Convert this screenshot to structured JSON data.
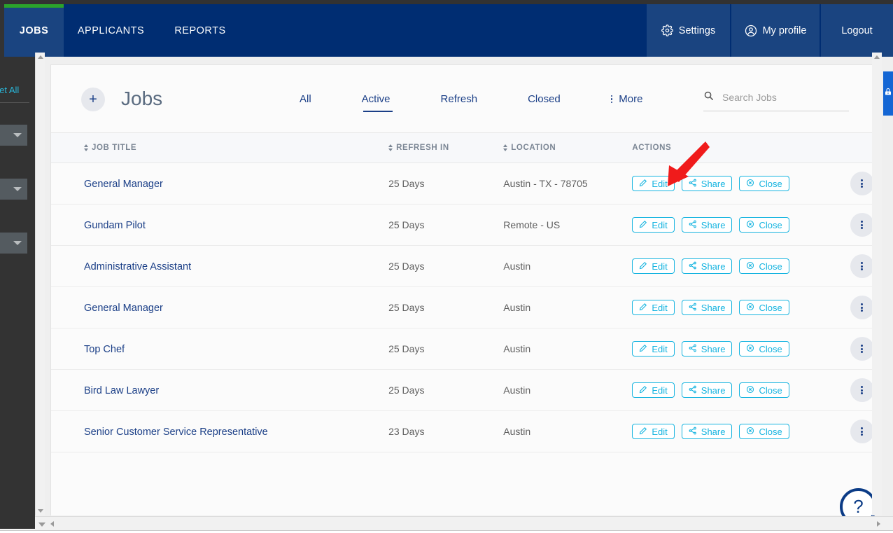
{
  "topnav": {
    "left_items": [
      {
        "label": "JOBS",
        "selected": true
      },
      {
        "label": "APPLICANTS",
        "selected": false
      },
      {
        "label": "REPORTS",
        "selected": false
      }
    ],
    "right_items": [
      {
        "label": "Settings",
        "icon": "gear-icon"
      },
      {
        "label": "My profile",
        "icon": "user-circle-icon"
      },
      {
        "label": "Logout",
        "icon": ""
      }
    ],
    "accent_color": "#2ba32b",
    "background_color": "#002d72",
    "active_color": "#1a4480"
  },
  "sidebar": {
    "reset_all_label": "Reset All",
    "reset_all_color": "#29b6d8"
  },
  "page": {
    "title": "Jobs",
    "add_button_label": "+",
    "tabs": [
      {
        "label": "All",
        "selected": false
      },
      {
        "label": "Active",
        "selected": true
      },
      {
        "label": "Refresh",
        "selected": false
      },
      {
        "label": "Closed",
        "selected": false
      },
      {
        "label": "More",
        "selected": false,
        "icon": "kebab-icon"
      }
    ],
    "search": {
      "placeholder": "Search Jobs",
      "value": "",
      "icon": "search-icon"
    }
  },
  "table": {
    "columns": [
      {
        "label": "JOB TITLE",
        "sortable": true
      },
      {
        "label": "REFRESH IN",
        "sortable": true
      },
      {
        "label": "LOCATION",
        "sortable": true
      },
      {
        "label": "ACTIONS",
        "sortable": false
      }
    ],
    "action_buttons": [
      {
        "label": "Edit",
        "icon": "pencil-icon"
      },
      {
        "label": "Share",
        "icon": "share-nodes-icon"
      },
      {
        "label": "Close",
        "icon": "circle-x-icon"
      }
    ],
    "action_color": "#16b4e0",
    "rows": [
      {
        "title": "General Manager",
        "refresh_in": "25 Days",
        "location": "Austin - TX - 78705"
      },
      {
        "title": "Gundam Pilot",
        "refresh_in": "25 Days",
        "location": "Remote - US"
      },
      {
        "title": "Administrative Assistant",
        "refresh_in": "25 Days",
        "location": "Austin"
      },
      {
        "title": "General Manager",
        "refresh_in": "25 Days",
        "location": "Austin"
      },
      {
        "title": "Top Chef",
        "refresh_in": "25 Days",
        "location": "Austin"
      },
      {
        "title": "Bird Law Lawyer",
        "refresh_in": "25 Days",
        "location": "Austin"
      },
      {
        "title": "Senior Customer Service Representative",
        "refresh_in": "23 Days",
        "location": "Austin"
      }
    ]
  },
  "help": {
    "label": "?"
  },
  "annotation": {
    "arrow_color": "#f01b1b",
    "points_at": "Share"
  }
}
